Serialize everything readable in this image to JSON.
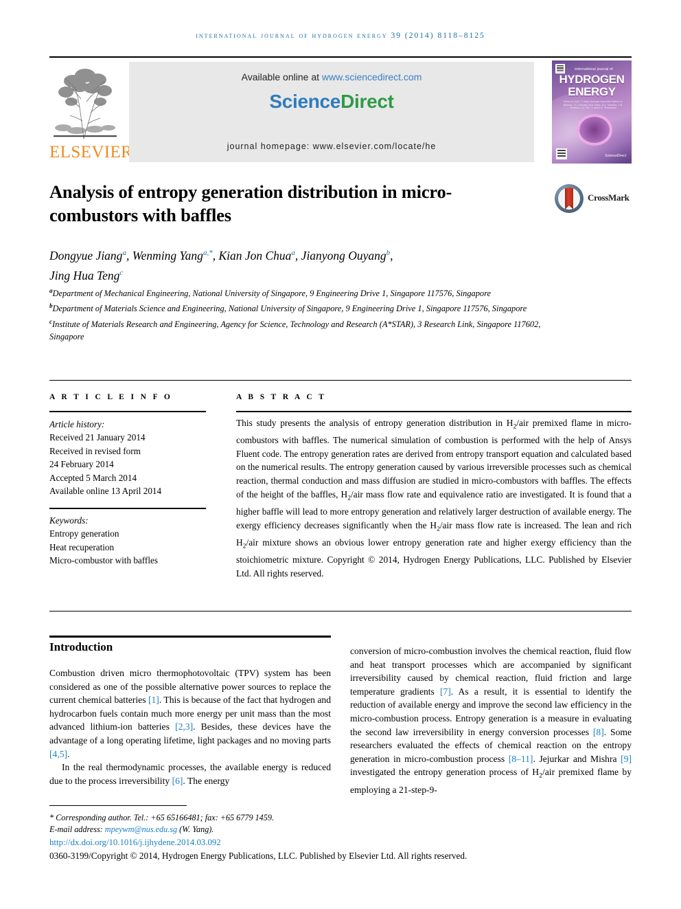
{
  "running_head": "international journal of hydrogen energy 39 (2014) 8118–8125",
  "masthead": {
    "available_prefix": "Available online at ",
    "available_url": "www.sciencedirect.com",
    "sciencedirect_sci": "Science",
    "sciencedirect_direct": "Direct",
    "homepage": "journal homepage: www.elsevier.com/locate/he",
    "publisher": "ELSEVIER",
    "cover": {
      "small_top": "international journal of",
      "title_line1": "HYDROGEN",
      "title_line2": "ENERGY",
      "editors": "Editor-in-Chief: T. Nejat Veziroglu   Associate Editors: A. Bielecki, T.C. Graham, M.R. Islam, M.Z. Mescher, J.M. Norbeck, L.A. Pan, T. and E.K. Stefanakos",
      "sd_label": "ScienceDirect"
    }
  },
  "crossmark": {
    "label": "CrossMark"
  },
  "article": {
    "title": "Analysis of entropy generation distribution in micro-combustors with baffles",
    "authors": [
      {
        "name": "Dongyue Jiang",
        "sup": "a"
      },
      {
        "name": "Wenming Yang",
        "sup": "a,*"
      },
      {
        "name": "Kian Jon Chua",
        "sup": "a"
      },
      {
        "name": "Jianyong Ouyang",
        "sup": "b"
      },
      {
        "name": "Jing Hua Teng",
        "sup": "c"
      }
    ],
    "affiliations": [
      {
        "mark": "a",
        "text": "Department of Mechanical Engineering, National University of Singapore, 9 Engineering Drive 1, Singapore 117576, Singapore"
      },
      {
        "mark": "b",
        "text": "Department of Materials Science and Engineering, National University of Singapore, 9 Engineering Drive 1, Singapore 117576, Singapore"
      },
      {
        "mark": "c",
        "text": "Institute of Materials Research and Engineering, Agency for Science, Technology and Research (A*STAR), 3 Research Link, Singapore 117602, Singapore"
      }
    ]
  },
  "article_info": {
    "heading": "A R T I C L E   I N F O",
    "history_label": "Article history:",
    "history": [
      "Received 21 January 2014",
      "Received in revised form",
      "24 February 2014",
      "Accepted 5 March 2014",
      "Available online 13 April 2014"
    ],
    "keywords_label": "Keywords:",
    "keywords": [
      "Entropy generation",
      "Heat recuperation",
      "Micro-combustor with baffles"
    ]
  },
  "abstract": {
    "heading": "A B S T R A C T",
    "body": "This study presents the analysis of entropy generation distribution in H2/air premixed flame in micro-combustors with baffles. The numerical simulation of combustion is performed with the help of Ansys Fluent code. The entropy generation rates are derived from entropy transport equation and calculated based on the numerical results. The entropy generation caused by various irreversible processes such as chemical reaction, thermal conduction and mass diffusion are studied in micro-combustors with baffles. The effects of the height of the baffles, H2/air mass flow rate and equivalence ratio are investigated. It is found that a higher baffle will lead to more entropy generation and relatively larger destruction of available energy. The exergy efficiency decreases significantly when the H2/air mass flow rate is increased. The lean and rich H2/air mixture shows an obvious lower entropy generation rate and higher exergy efficiency than the stoichiometric mixture.",
    "copyright": "Copyright © 2014, Hydrogen Energy Publications, LLC. Published by Elsevier Ltd. All rights reserved."
  },
  "introduction": {
    "heading": "Introduction",
    "left_paragraph_1": "Combustion driven micro thermophotovoltaic (TPV) system has been considered as one of the possible alternative power sources to replace the current chemical batteries [1]. This is because of the fact that hydrogen and hydrocarbon fuels contain much more energy per unit mass than the most advanced lithium-ion batteries [2,3]. Besides, these devices have the advantage of a long operating lifetime, light packages and no moving parts [4,5].",
    "left_paragraph_2": "In the real thermodynamic processes, the available energy is reduced due to the process irreversibility [6]. The energy",
    "right_paragraph_1": "conversion of micro-combustion involves the chemical reaction, fluid flow and heat transport processes which are accompanied by significant irreversibility caused by chemical reaction, fluid friction and large temperature gradients [7]. As a result, it is essential to identify the reduction of available energy and improve the second law efficiency in the micro-combustion process. Entropy generation is a measure in evaluating the second law irreversibility in energy conversion processes [8]. Some researchers evaluated the effects of chemical reaction on the entropy generation in micro-combustion process [8–11]. Jejurkar and Mishra [9] investigated the entropy generation process of H2/air premixed flame by employing a 21-step-9-",
    "references": [
      "[1]",
      "[2,3]",
      "[4,5]",
      "[6]",
      "[7]",
      "[8]",
      "[8–11]",
      "[9]"
    ]
  },
  "footer": {
    "corresponding": "* Corresponding author. Tel.: +65 65166481; fax: +65 6779 1459.",
    "email_label": "E-mail address: ",
    "email": "mpeywm@nus.edu.sg",
    "email_suffix": " (W. Yang).",
    "doi": "http://dx.doi.org/10.1016/j.ijhydene.2014.03.092",
    "copyright": "0360-3199/Copyright © 2014, Hydrogen Energy Publications, LLC. Published by Elsevier Ltd. All rights reserved."
  },
  "colors": {
    "accent_blue": "#1a6ea8",
    "link_blue": "#1a7fc0",
    "sciencedirect_green": "#2e9b45",
    "elsevier_orange": "#f08a20",
    "crossmark_red": "#b42a18"
  }
}
